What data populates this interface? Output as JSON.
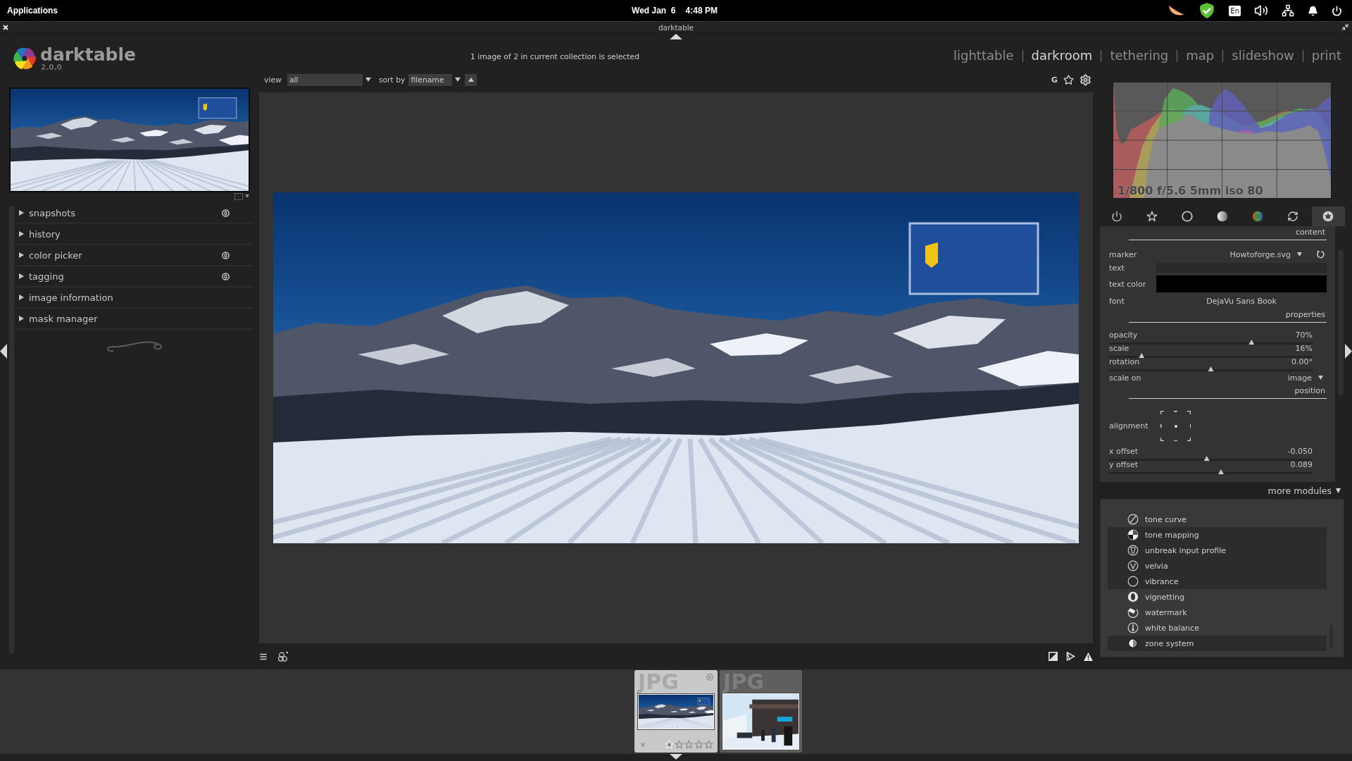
{
  "system_bar": {
    "menu": "Applications",
    "date": "Wed Jan  6",
    "time": "4:48 PM",
    "keyboard_layout": "En"
  },
  "window": {
    "title": "darktable"
  },
  "header": {
    "app_name": "darktable",
    "version": "2.0.0",
    "status": "1 image of 2 in current collection is selected",
    "views": [
      {
        "label": "lighttable",
        "selected": false
      },
      {
        "label": "darkroom",
        "selected": true
      },
      {
        "label": "tethering",
        "selected": false
      },
      {
        "label": "map",
        "selected": false
      },
      {
        "label": "slideshow",
        "selected": false
      },
      {
        "label": "print",
        "selected": false
      }
    ]
  },
  "left_panel": {
    "modules": [
      {
        "label": "snapshots",
        "expanded": false,
        "reset_button": true
      },
      {
        "label": "history",
        "expanded": false,
        "reset_button": false
      },
      {
        "label": "color picker",
        "expanded": false,
        "reset_button": true
      },
      {
        "label": "tagging",
        "expanded": false,
        "reset_button": true
      },
      {
        "label": "image information",
        "expanded": false,
        "reset_button": false
      },
      {
        "label": "mask manager",
        "expanded": false,
        "reset_button": false
      }
    ]
  },
  "center_toolbar": {
    "view_label": "view",
    "view_value": "all",
    "sort_label": "sort by",
    "sort_value": "filename",
    "grouping": "G"
  },
  "right_panel": {
    "histogram": {
      "exif": "1/800 f/5.6 5mm iso 80"
    },
    "module_groups": [
      {
        "kind": "power",
        "selected": false
      },
      {
        "kind": "favorites",
        "selected": false
      },
      {
        "kind": "basic",
        "selected": false
      },
      {
        "kind": "tone",
        "selected": false
      },
      {
        "kind": "color",
        "selected": false
      },
      {
        "kind": "correct",
        "selected": false
      },
      {
        "kind": "effect",
        "selected": true
      }
    ],
    "watermark_rows": [
      {
        "kind": "heading",
        "label": "content"
      },
      {
        "kind": "combo",
        "label": "marker",
        "value": "Howtoforge.svg",
        "reset": true
      },
      {
        "kind": "entry",
        "label": "text"
      },
      {
        "kind": "color",
        "label": "text color",
        "color": "#000000"
      },
      {
        "kind": "button",
        "label": "font",
        "value": "DejaVu Sans Book"
      },
      {
        "kind": "heading",
        "label": "properties"
      },
      {
        "kind": "slider",
        "label": "opacity",
        "value": "70%",
        "level": 0.7
      },
      {
        "kind": "slider",
        "label": "scale",
        "value": "16%",
        "level": 0.16
      },
      {
        "kind": "slider",
        "label": "rotation",
        "value": "0.00°",
        "level": 0.5
      },
      {
        "kind": "combo",
        "label": "scale on",
        "value": "image",
        "reset": false
      },
      {
        "kind": "heading",
        "label": "position"
      },
      {
        "kind": "alignment",
        "label": "alignment",
        "cells": [
          {
            "selected": false
          },
          {
            "selected": false
          },
          {
            "selected": false
          },
          {
            "selected": false
          },
          {
            "selected": true
          },
          {
            "selected": false
          },
          {
            "selected": false
          },
          {
            "selected": false
          },
          {
            "selected": false
          }
        ]
      },
      {
        "kind": "slider",
        "label": "x offset",
        "value": "-0.050",
        "level": 0.48
      },
      {
        "kind": "slider",
        "label": "y offset",
        "value": "0.089",
        "level": 0.55
      }
    ],
    "more_modules": {
      "label": "more modules",
      "expanded": true,
      "items": [
        {
          "label": "tone curve",
          "kind": "tonecurve",
          "highlighted": true
        },
        {
          "label": "tone mapping",
          "kind": "tonemap",
          "highlighted": false
        },
        {
          "label": "unbreak input profile",
          "kind": "unbreak",
          "highlighted": false
        },
        {
          "label": "velvia",
          "kind": "velvia",
          "highlighted": false
        },
        {
          "label": "vibrance",
          "kind": "vibrance",
          "highlighted": false
        },
        {
          "label": "vignetting",
          "kind": "vignette",
          "highlighted": true
        },
        {
          "label": "watermark",
          "kind": "watermark",
          "highlighted": true
        },
        {
          "label": "white balance",
          "kind": "whitebalance",
          "highlighted": true
        },
        {
          "label": "zone system",
          "kind": "zonesystem",
          "highlighted": false
        }
      ]
    }
  },
  "filmstrip": {
    "thumbnails": [
      {
        "kind": "landscape",
        "format": "JPG",
        "selected": true,
        "stars": 1
      },
      {
        "kind": "street",
        "format": "JPG",
        "selected": false
      }
    ]
  }
}
